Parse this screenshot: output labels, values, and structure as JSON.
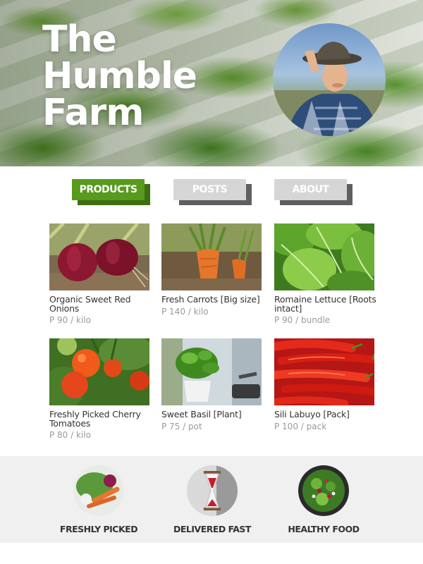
{
  "hero": {
    "title_lines": [
      "The",
      "Humble",
      "Farm"
    ]
  },
  "tabs": [
    {
      "label": "PRODUCTS",
      "active": true
    },
    {
      "label": "POSTS",
      "active": false
    },
    {
      "label": "ABOUT",
      "active": false
    }
  ],
  "products": [
    {
      "name": "Organic Sweet Red Onions",
      "price": "P 90 / kilo"
    },
    {
      "name": "Fresh Carrots [Big size]",
      "price": "P 140 / kilo"
    },
    {
      "name": "Romaine Lettuce [Roots intact]",
      "price": "P 90 / bundle"
    },
    {
      "name": "Freshly Picked Cherry Tomatoes",
      "price": "P 80 / kilo"
    },
    {
      "name": "Sweet Basil [Plant]",
      "price": "P 75 / pot"
    },
    {
      "name": "Sili Labuyo [Pack]",
      "price": "P 100 / pack"
    }
  ],
  "features": [
    {
      "label": "FRESHLY PICKED"
    },
    {
      "label": "DELIVERED FAST"
    },
    {
      "label": "HEALTHY FOOD"
    }
  ],
  "colors": {
    "accent_green": "#579a1d",
    "tab_inactive": "#d6d6d6",
    "footer_bg": "#f0f0f0"
  }
}
